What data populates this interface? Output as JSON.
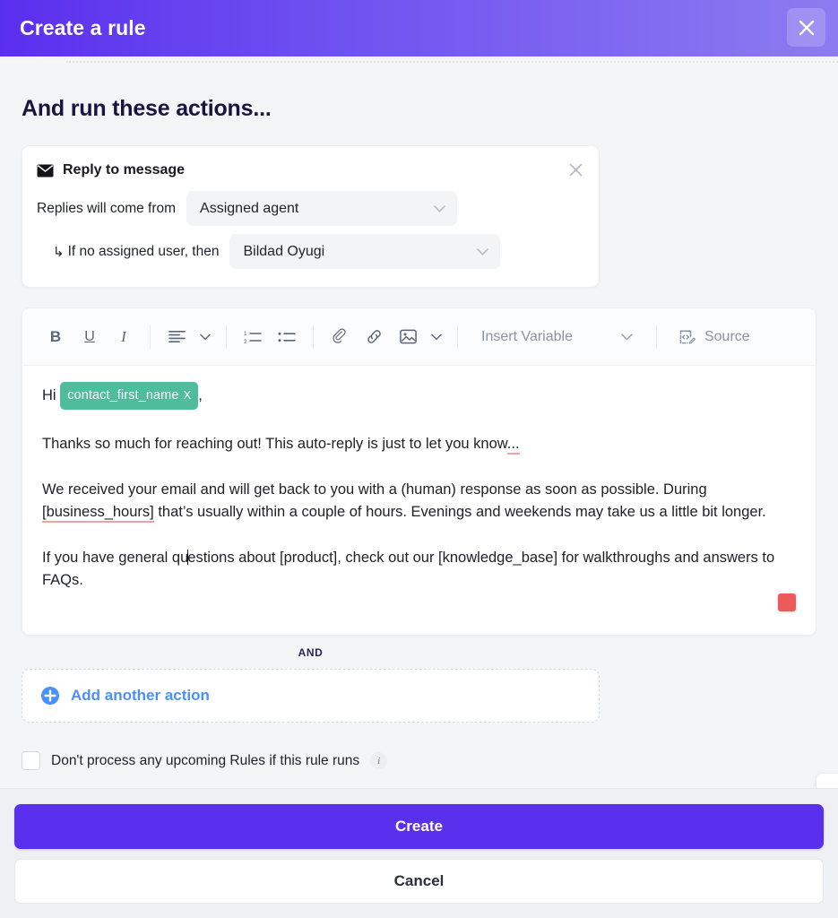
{
  "header": {
    "title": "Create a rule",
    "close_label": "Close",
    "gradient_from": "#5b2fee",
    "gradient_to": "#8d7bf0"
  },
  "main": {
    "section_title": "And run these actions...",
    "action_card": {
      "icon": "envelope-icon",
      "title": "Reply to message",
      "remove_label": "Remove action",
      "fields": [
        {
          "label": "Replies will come from",
          "value": "Assigned agent",
          "icon": "chevron-down-icon"
        },
        {
          "arrow": "↳",
          "label": "If no assigned user, then",
          "value": "Bildad Oyugi",
          "icon": "chevron-down-icon"
        }
      ]
    },
    "editor": {
      "toolbar": {
        "bold": "B",
        "underline": "U",
        "italic": "I",
        "align": "align-left-icon",
        "align_chevron": "chevron-down-icon",
        "numbered_list": "numbered-list-icon",
        "bullet_list": "bullet-list-icon",
        "attach": "paperclip-icon",
        "link": "link-icon",
        "image": "image-icon",
        "image_chevron": "chevron-down-icon",
        "insert_variable": "Insert Variable",
        "insert_variable_chevron": "chevron-down-icon",
        "source_icon": "source-code-icon",
        "source": "Source"
      },
      "content": {
        "greeting_prefix": "Hi",
        "variable_chip": "contact_first_name",
        "variable_chip_remove": "X",
        "greeting_suffix": ",",
        "paragraph_1_a": "Thanks so much for reaching out! This auto-reply is just to let you know",
        "paragraph_1_misspelled": "...",
        "paragraph_2_a": "We received your email and will get back to you with a (human) response as soon as possible. During ",
        "paragraph_2_misspelled": "[business_hours]",
        "paragraph_2_b": " that’s usually within a couple of hours. Evenings and weekends may take us a little bit longer.",
        "paragraph_3_a": "If you have general qu",
        "paragraph_3_b": "estions about [product], check out our [knowledge_base] for walkthroughs and answers to FAQs.",
        "record_indicator": "record-stop-icon"
      }
    },
    "and_label": "AND",
    "add_action": {
      "icon": "plus-circle-icon",
      "label": "Add another action"
    },
    "checkbox_row": {
      "checked": false,
      "label": "Don't process any upcoming Rules if this rule runs",
      "info_icon": "info-icon",
      "info_glyph": "i"
    },
    "side_tab": {
      "icon": "signature-icon"
    }
  },
  "footer": {
    "create_label": "Create",
    "cancel_label": "Cancel",
    "create_color": "#5b2fee"
  }
}
